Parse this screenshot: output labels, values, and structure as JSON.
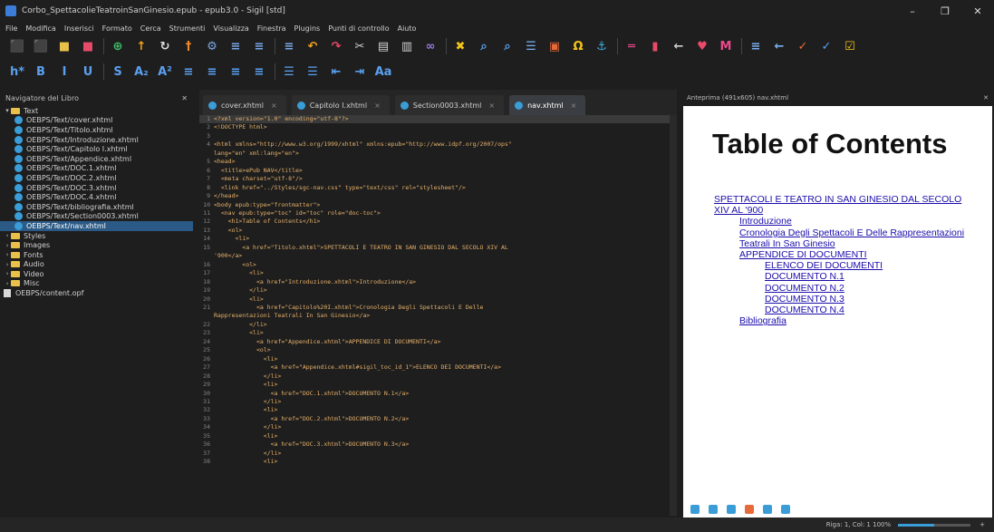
{
  "window": {
    "title": "Corbo_SpettacolieTeatroinSanGinesio.epub - epub3.0 - Sigil [std]",
    "min": "–",
    "restore": "❐",
    "close": "✕"
  },
  "menu": [
    "File",
    "Modifica",
    "Inserisci",
    "Formato",
    "Cerca",
    "Strumenti",
    "Visualizza",
    "Finestra",
    "Plugins",
    "Punti di controllo",
    "Aiuto"
  ],
  "toolbar1": [
    {
      "icon": "new-book-icon",
      "glyph": "⬛",
      "color": "#3a8ee6"
    },
    {
      "icon": "open-book-icon",
      "glyph": "⬛",
      "color": "#3a8ee6"
    },
    {
      "icon": "folder-icon",
      "glyph": "■",
      "color": "#e9c14a"
    },
    {
      "icon": "save-icon",
      "glyph": "■",
      "color": "#e84a6a"
    },
    {
      "icon": "add-file-icon",
      "glyph": "⊕",
      "color": "#3cc06a"
    },
    {
      "icon": "arrow-up-icon",
      "glyph": "↑",
      "color": "#f3a41a"
    },
    {
      "icon": "refresh-icon",
      "glyph": "↻",
      "color": "#e0e0e0"
    },
    {
      "icon": "split-icon",
      "glyph": "†",
      "color": "#f08a2b"
    },
    {
      "icon": "gear-icon",
      "glyph": "⚙",
      "color": "#7aa7e6"
    },
    {
      "icon": "list-indent-icon",
      "glyph": "≡",
      "color": "#7aa7e6"
    },
    {
      "icon": "list-indent-2-icon",
      "glyph": "≡",
      "color": "#7aa7e6"
    },
    {
      "icon": "list-indent-3-icon",
      "glyph": "≡",
      "color": "#7aa7e6"
    },
    {
      "icon": "undo-icon",
      "glyph": "↶",
      "color": "#f3a41a"
    },
    {
      "icon": "redo-icon",
      "glyph": "↷",
      "color": "#e84a6a"
    },
    {
      "icon": "cut-icon",
      "glyph": "✂",
      "color": "#d0d0d0"
    },
    {
      "icon": "copy-icon",
      "glyph": "▤",
      "color": "#d0d0d0"
    },
    {
      "icon": "paste-icon",
      "glyph": "▥",
      "color": "#d0d0d0"
    },
    {
      "icon": "link-icon",
      "glyph": "∞",
      "color": "#9a7ae0"
    },
    {
      "icon": "tools-icon",
      "glyph": "✖",
      "color": "#f3c41a"
    },
    {
      "icon": "zoom-icon",
      "glyph": "⌕",
      "color": "#5aa0f0"
    },
    {
      "icon": "search-replace-icon",
      "glyph": "⌕",
      "color": "#5aa0f0"
    },
    {
      "icon": "table-icon",
      "glyph": "☰",
      "color": "#7ab0f0"
    },
    {
      "icon": "image-icon",
      "glyph": "▣",
      "color": "#e86a3a"
    },
    {
      "icon": "omega-icon",
      "glyph": "Ω",
      "color": "#f3c41a"
    },
    {
      "icon": "anchor-icon",
      "glyph": "⚓",
      "color": "#3cb0e0"
    },
    {
      "icon": "hyperlink-icon",
      "glyph": "═",
      "color": "#e84a8a"
    },
    {
      "icon": "bookmark-icon",
      "glyph": "▮",
      "color": "#e84a6a"
    },
    {
      "icon": "back-icon",
      "glyph": "←",
      "color": "#d0d0d0"
    },
    {
      "icon": "heart-icon",
      "glyph": "♥",
      "color": "#e84a6a"
    },
    {
      "icon": "metadata-icon",
      "glyph": "M",
      "color": "#e84a8a"
    },
    {
      "icon": "toc-icon",
      "glyph": "≡",
      "color": "#7ab0f0"
    },
    {
      "icon": "prev-icon",
      "glyph": "←",
      "color": "#7ab0f0"
    },
    {
      "icon": "check-icon",
      "glyph": "✓",
      "color": "#e86a3a"
    },
    {
      "icon": "validate-icon",
      "glyph": "✓",
      "color": "#5aa0f0"
    },
    {
      "icon": "spell-icon",
      "glyph": "☑",
      "color": "#f3c41a"
    }
  ],
  "toolbar2": [
    {
      "icon": "heading-icon",
      "glyph": "h*",
      "color": "#5aa0f0"
    },
    {
      "icon": "bold-icon",
      "glyph": "B",
      "color": "#5aa0f0"
    },
    {
      "icon": "italic-icon",
      "glyph": "I",
      "color": "#5aa0f0"
    },
    {
      "icon": "underline-icon",
      "glyph": "U",
      "color": "#5aa0f0"
    },
    {
      "icon": "strikethrough-icon",
      "glyph": "S",
      "color": "#5aa0f0"
    },
    {
      "icon": "subscript-icon",
      "glyph": "A₂",
      "color": "#5aa0f0"
    },
    {
      "icon": "superscript-icon",
      "glyph": "A²",
      "color": "#5aa0f0"
    },
    {
      "icon": "align-left-icon",
      "glyph": "≡",
      "color": "#5aa0f0"
    },
    {
      "icon": "align-center-icon",
      "glyph": "≡",
      "color": "#5aa0f0"
    },
    {
      "icon": "align-right-icon",
      "glyph": "≡",
      "color": "#5aa0f0"
    },
    {
      "icon": "justify-icon",
      "glyph": "≡",
      "color": "#5aa0f0"
    },
    {
      "icon": "bullet-list-icon",
      "glyph": "☰",
      "color": "#5aa0f0"
    },
    {
      "icon": "number-list-icon",
      "glyph": "☰",
      "color": "#5aa0f0"
    },
    {
      "icon": "indent-decrease-icon",
      "glyph": "⇤",
      "color": "#5aa0f0"
    },
    {
      "icon": "indent-increase-icon",
      "glyph": "⇥",
      "color": "#5aa0f0"
    },
    {
      "icon": "case-icon",
      "glyph": "Aa",
      "color": "#5aa0f0"
    }
  ],
  "navigator": {
    "title": "Navigatore del Libro",
    "tree": [
      {
        "type": "folder",
        "label": "Text",
        "open": true,
        "indent": 0
      },
      {
        "type": "file",
        "label": "OEBPS/Text/cover.xhtml",
        "indent": 1
      },
      {
        "type": "file",
        "label": "OEBPS/Text/Titolo.xhtml",
        "indent": 1
      },
      {
        "type": "file",
        "label": "OEBPS/Text/Introduzione.xhtml",
        "indent": 1
      },
      {
        "type": "file",
        "label": "OEBPS/Text/Capitolo I.xhtml",
        "indent": 1
      },
      {
        "type": "file",
        "label": "OEBPS/Text/Appendice.xhtml",
        "indent": 1
      },
      {
        "type": "file",
        "label": "OEBPS/Text/DOC.1.xhtml",
        "indent": 1
      },
      {
        "type": "file",
        "label": "OEBPS/Text/DOC.2.xhtml",
        "indent": 1
      },
      {
        "type": "file",
        "label": "OEBPS/Text/DOC.3.xhtml",
        "indent": 1
      },
      {
        "type": "file",
        "label": "OEBPS/Text/DOC.4.xhtml",
        "indent": 1
      },
      {
        "type": "file",
        "label": "OEBPS/Text/bibliografia.xhtml",
        "indent": 1
      },
      {
        "type": "file",
        "label": "OEBPS/Text/Section0003.xhtml",
        "indent": 1
      },
      {
        "type": "file",
        "label": "OEBPS/Text/nav.xhtml",
        "indent": 1,
        "selected": true
      },
      {
        "type": "folder",
        "label": "Styles",
        "open": false,
        "indent": 0
      },
      {
        "type": "folder",
        "label": "Images",
        "open": false,
        "indent": 0
      },
      {
        "type": "folder",
        "label": "Fonts",
        "open": false,
        "indent": 0
      },
      {
        "type": "folder",
        "label": "Audio",
        "open": false,
        "indent": 0
      },
      {
        "type": "folder",
        "label": "Video",
        "open": false,
        "indent": 0
      },
      {
        "type": "folder",
        "label": "Misc",
        "open": false,
        "indent": 0
      },
      {
        "type": "opf",
        "label": "OEBPS/content.opf",
        "indent": 0
      }
    ]
  },
  "tabs": [
    {
      "label": "cover.xhtml",
      "active": false
    },
    {
      "label": "Capitolo I.xhtml",
      "active": false
    },
    {
      "label": "Section0003.xhtml",
      "active": false
    },
    {
      "label": "nav.xhtml",
      "active": true
    }
  ],
  "code": [
    {
      "n": "1",
      "t": "<?xml version=\"1.0\" encoding=\"utf-8\"?>",
      "cur": true
    },
    {
      "n": "2",
      "t": "<!DOCTYPE html>"
    },
    {
      "n": "3",
      "t": ""
    },
    {
      "n": "4",
      "t": "<html xmlns=\"http://www.w3.org/1999/xhtml\" xmlns:epub=\"http://www.idpf.org/2007/ops\""
    },
    {
      "n": "",
      "t": "lang=\"en\" xml:lang=\"en\">"
    },
    {
      "n": "5",
      "t": "<head>"
    },
    {
      "n": "6",
      "t": "  <title>ePub NAV</title>"
    },
    {
      "n": "7",
      "t": "  <meta charset=\"utf-8\"/>"
    },
    {
      "n": "8",
      "t": "  <link href=\"../Styles/sgc-nav.css\" type=\"text/css\" rel=\"stylesheet\"/>"
    },
    {
      "n": "9",
      "t": "</head>"
    },
    {
      "n": "10",
      "t": "<body epub:type=\"frontmatter\">"
    },
    {
      "n": "11",
      "t": "  <nav epub:type=\"toc\" id=\"toc\" role=\"doc-toc\">"
    },
    {
      "n": "12",
      "t": "    <h1>Table of Contents</h1>"
    },
    {
      "n": "13",
      "t": "    <ol>"
    },
    {
      "n": "14",
      "t": "      <li>"
    },
    {
      "n": "15",
      "t": "        <a href=\"Titolo.xhtml\">SPETTACOLI E TEATRO IN SAN GINESIO DAL SECOLO XIV AL"
    },
    {
      "n": "",
      "t": "'900</a>"
    },
    {
      "n": "16",
      "t": "        <ol>"
    },
    {
      "n": "17",
      "t": "          <li>"
    },
    {
      "n": "18",
      "t": "            <a href=\"Introduzione.xhtml\">Introduzione</a>"
    },
    {
      "n": "19",
      "t": "          </li>"
    },
    {
      "n": "20",
      "t": "          <li>"
    },
    {
      "n": "21",
      "t": "            <a href=\"Capitolo%20I.xhtml\">Cronologia Degli Spettacoli E Delle"
    },
    {
      "n": "",
      "t": "Rappresentazioni Teatrali In San Ginesio</a>"
    },
    {
      "n": "22",
      "t": "          </li>"
    },
    {
      "n": "23",
      "t": "          <li>"
    },
    {
      "n": "24",
      "t": "            <a href=\"Appendice.xhtml\">APPENDICE DI DOCUMENTI</a>"
    },
    {
      "n": "25",
      "t": "            <ol>"
    },
    {
      "n": "26",
      "t": "              <li>"
    },
    {
      "n": "27",
      "t": "                <a href=\"Appendice.xhtml#sigil_toc_id_1\">ELENCO DEI DOCUMENTI</a>"
    },
    {
      "n": "28",
      "t": "              </li>"
    },
    {
      "n": "29",
      "t": "              <li>"
    },
    {
      "n": "30",
      "t": "                <a href=\"DOC.1.xhtml\">DOCUMENTO N.1</a>"
    },
    {
      "n": "31",
      "t": "              </li>"
    },
    {
      "n": "32",
      "t": "              <li>"
    },
    {
      "n": "33",
      "t": "                <a href=\"DOC.2.xhtml\">DOCUMENTO N.2</a>"
    },
    {
      "n": "34",
      "t": "              </li>"
    },
    {
      "n": "35",
      "t": "              <li>"
    },
    {
      "n": "36",
      "t": "                <a href=\"DOC.3.xhtml\">DOCUMENTO N.3</a>"
    },
    {
      "n": "37",
      "t": "              </li>"
    },
    {
      "n": "38",
      "t": "              <li>"
    }
  ],
  "preview": {
    "title": "Anteprima (491x605) nav.xhtml",
    "heading": "Table of Contents",
    "toc": [
      {
        "label": "SPETTACOLI E TEATRO IN SAN GINESIO DAL SECOLO",
        "level": 1
      },
      {
        "label": "XIV AL '900",
        "level": 1
      },
      {
        "label": "Introduzione",
        "level": 2
      },
      {
        "label": "Cronologia Degli Spettacoli E Delle Rappresentazioni",
        "level": 2
      },
      {
        "label": "Teatrali In San Ginesio",
        "level": 2
      },
      {
        "label": "APPENDICE DI DOCUMENTI",
        "level": 2
      },
      {
        "label": "ELENCO DEI DOCUMENTI",
        "level": 3
      },
      {
        "label": "DOCUMENTO N.1",
        "level": 3
      },
      {
        "label": "DOCUMENTO N.2",
        "level": 3
      },
      {
        "label": "DOCUMENTO N.3",
        "level": 3
      },
      {
        "label": "DOCUMENTO N.4",
        "level": 3
      },
      {
        "label": "Bibliografia",
        "level": 2
      }
    ],
    "tools": [
      {
        "icon": "inspect-icon",
        "color": "#3a9dd8"
      },
      {
        "icon": "grid-icon",
        "color": "#3a9dd8"
      },
      {
        "icon": "copy-icon",
        "color": "#3a9dd8"
      },
      {
        "icon": "refresh-icon",
        "color": "#e86a3a"
      },
      {
        "icon": "settings-icon",
        "color": "#3a9dd8"
      },
      {
        "icon": "globe-icon",
        "color": "#3a9dd8"
      }
    ]
  },
  "status": {
    "text": "Riga: 1, Col: 1  100%",
    "zoom_fraction": 0.5
  }
}
